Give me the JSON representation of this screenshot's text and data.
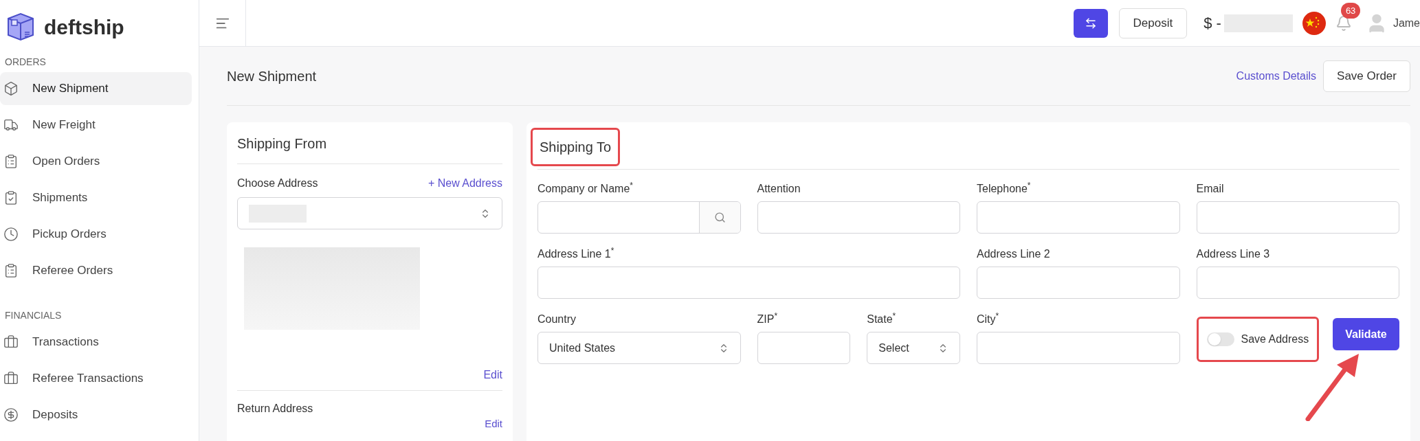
{
  "brand": {
    "name": "deftship"
  },
  "sidebar": {
    "sections": [
      {
        "title": "ORDERS",
        "items": [
          {
            "label": "New Shipment",
            "selected": true
          },
          {
            "label": "New Freight",
            "selected": false
          },
          {
            "label": "Open Orders",
            "selected": false
          },
          {
            "label": "Shipments",
            "selected": false
          },
          {
            "label": "Pickup Orders",
            "selected": false
          },
          {
            "label": "Referee Orders",
            "selected": false
          }
        ]
      },
      {
        "title": "FINANCIALS",
        "items": [
          {
            "label": "Transactions",
            "selected": false
          },
          {
            "label": "Referee Transactions",
            "selected": false
          },
          {
            "label": "Deposits",
            "selected": false
          }
        ]
      }
    ]
  },
  "header": {
    "deposit_button": "Deposit",
    "balance_prefix": "$ -",
    "notifications_count": "63",
    "user_name": "Jame"
  },
  "page": {
    "title": "New Shipment",
    "customs_link": "Customs Details",
    "save_button": "Save Order"
  },
  "shipping_from": {
    "title": "Shipping From",
    "choose_label": "Choose Address",
    "new_address_link": "+ New Address",
    "edit_link": "Edit",
    "return_label": "Return Address",
    "return_edit_link": "Edit"
  },
  "shipping_to": {
    "title": "Shipping To",
    "title_highlighted": true,
    "fields": [
      {
        "kind": "search",
        "label": "Company or Name$^{*}$"
      },
      {
        "kind": "text",
        "label": "Attention"
      },
      {
        "kind": "text",
        "label": "Telephone$^{*}$"
      },
      {
        "kind": "text",
        "label": "Email"
      },
      {
        "kind": "text",
        "label": "Address Line 1$^{*}$"
      },
      {
        "kind": "text",
        "label": "Address Line 2"
      },
      {
        "kind": "text",
        "label": "Address Line 3"
      },
      {
        "kind": "select",
        "label": "Country",
        "value": "United States"
      },
      {
        "kind": "text",
        "label": "ZIP$^{*}$"
      },
      {
        "kind": "select",
        "label": "State$^{*}$",
        "value": "Select"
      },
      {
        "kind": "text",
        "label": "City$^{*}$"
      }
    ],
    "save_address": {
      "label": "Save Address",
      "on": false,
      "highlighted": true
    },
    "validate_button": {
      "label": "Validate",
      "arrow_pointed": true
    }
  }
}
